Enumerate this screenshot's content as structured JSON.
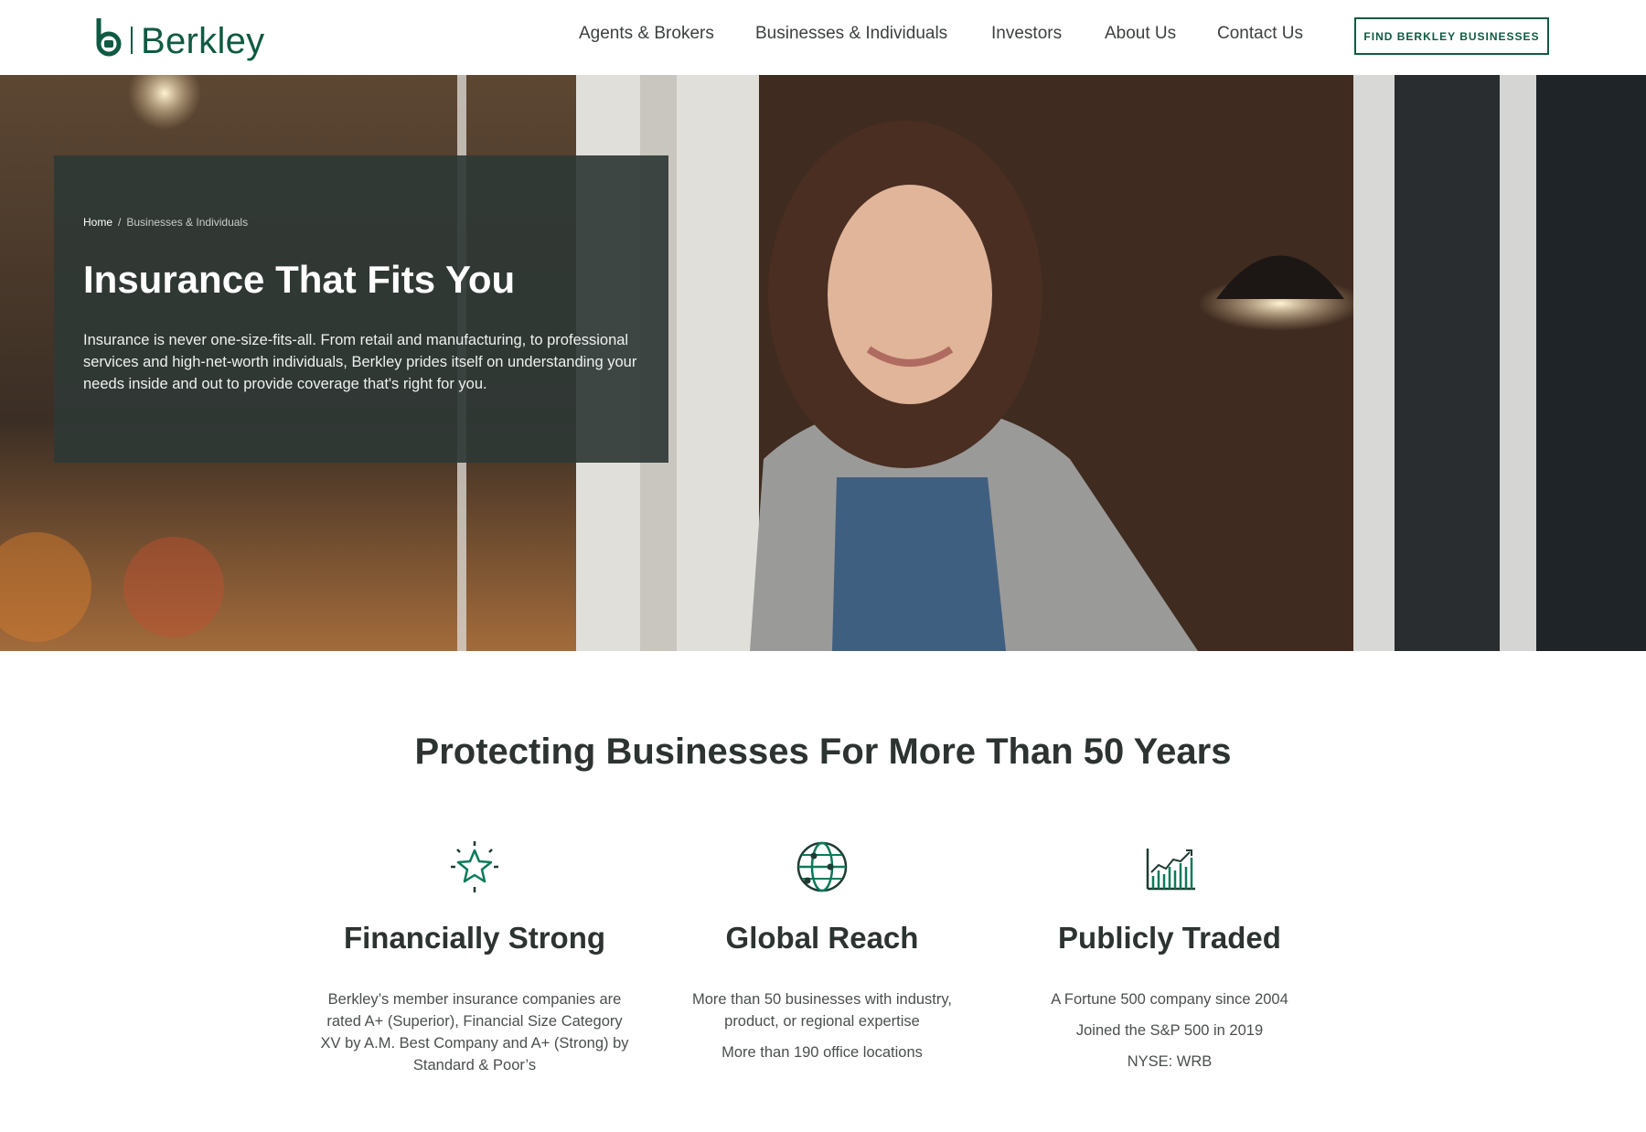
{
  "header": {
    "logo_text": "Berkley",
    "nav": [
      {
        "label": "Agents & Brokers"
      },
      {
        "label": "Businesses & Individuals"
      },
      {
        "label": "Investors"
      },
      {
        "label": "About Us"
      },
      {
        "label": "Contact Us"
      }
    ],
    "cta_label": "FIND BERKLEY BUSINESSES"
  },
  "hero": {
    "breadcrumb": {
      "home": "Home",
      "separator": "/",
      "current": "Businesses & Individuals"
    },
    "title": "Insurance That Fits You",
    "text": "Insurance is never one-size-fits-all. From retail and manufacturing, to professional services and high-net-worth individuals, Berkley prides itself on understanding your needs inside and out to provide coverage that's right for you."
  },
  "section": {
    "title": "Protecting Businesses For More Than 50 Years",
    "features": [
      {
        "icon": "star-icon",
        "title": "Financially Strong",
        "lines": [
          "Berkley’s member insurance companies are rated A+ (Superior), Financial Size Category XV by A.M. Best Company and A+ (Strong) by Standard & Poor’s"
        ]
      },
      {
        "icon": "globe-icon",
        "title": "Global Reach",
        "lines": [
          "More than 50 businesses with industry, product, or regional expertise",
          "More than 190 office locations"
        ]
      },
      {
        "icon": "growth-chart-icon",
        "title": "Publicly Traded",
        "lines": [
          "A Fortune 500 company since 2004",
          "Joined the S&P 500 in 2019",
          "NYSE: WRB"
        ]
      }
    ]
  },
  "colors": {
    "brand_green": "#0f5a43",
    "panel": "#2f3835",
    "icon_green": "#0b7a5a"
  }
}
